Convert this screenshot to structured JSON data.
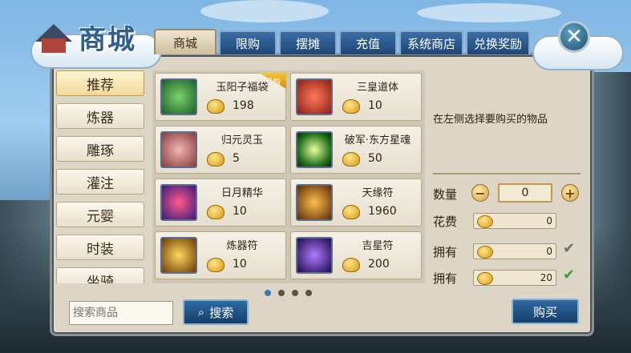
{
  "header": {
    "title": "商城",
    "tabs": [
      {
        "label": "商城",
        "active": true
      },
      {
        "label": "限购",
        "active": false
      },
      {
        "label": "摆摊",
        "active": false
      },
      {
        "label": "充值",
        "active": false
      },
      {
        "label": "系统商店",
        "active": false
      },
      {
        "label": "兑换奖励",
        "active": false
      }
    ],
    "close_icon": "close-icon"
  },
  "categories": [
    {
      "label": "推荐",
      "active": true
    },
    {
      "label": "炼器",
      "active": false
    },
    {
      "label": "雕琢",
      "active": false
    },
    {
      "label": "灌注",
      "active": false
    },
    {
      "label": "元婴",
      "active": false
    },
    {
      "label": "时装",
      "active": false
    },
    {
      "label": "坐骑",
      "active": false
    }
  ],
  "items": [
    {
      "name": "玉阳子福袋",
      "price": "198",
      "badge": "限购",
      "icon_color": "#2f8a3a"
    },
    {
      "name": "三皇道体",
      "price": "10",
      "badge": "",
      "icon_color": "#c23a2a"
    },
    {
      "name": "归元灵玉",
      "price": "5",
      "badge": "",
      "icon_color": "#c77a7a"
    },
    {
      "name": "破军·东方星魂",
      "price": "50",
      "badge": "",
      "icon_color": "#4fc13a"
    },
    {
      "name": "日月精华",
      "price": "10",
      "badge": "",
      "icon_color": "#b5246a"
    },
    {
      "name": "天缘符",
      "price": "1960",
      "badge": "",
      "icon_color": "#c98a1a"
    },
    {
      "name": "炼器符",
      "price": "10",
      "badge": "",
      "icon_color": "#d6a21a"
    },
    {
      "name": "吉星符",
      "price": "200",
      "badge": "",
      "icon_color": "#4a3fb1"
    }
  ],
  "pagination": {
    "pages": 4,
    "current": 1
  },
  "detail": {
    "hint": "在左侧选择要购买的物品",
    "quantity_label": "数量",
    "quantity": "0",
    "cost_label": "花费",
    "cost": "0",
    "owned_label_1": "拥有",
    "owned_1": "0",
    "owned_label_2": "拥有",
    "owned_2": "20"
  },
  "search": {
    "placeholder": "搜索商品",
    "button_label": "搜索"
  },
  "buy_label": "购买",
  "colors": {
    "tab_blue": "#1f4674",
    "accent_gold": "#d69a12",
    "check_green": "#3aa23a"
  }
}
